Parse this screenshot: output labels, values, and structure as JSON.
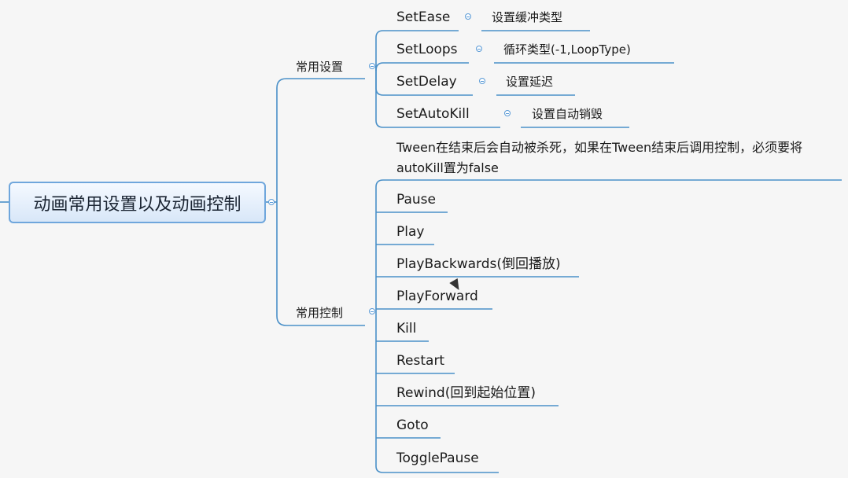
{
  "root": {
    "label": "动画常用设置以及动画控制"
  },
  "branches": {
    "settings": {
      "label": "常用设置",
      "children": [
        {
          "label": "SetEase",
          "note": "设置缓冲类型"
        },
        {
          "label": "SetLoops",
          "note": "循环类型(-1,LoopType)"
        },
        {
          "label": "SetDelay",
          "note": "设置延迟"
        },
        {
          "label": "SetAutoKill",
          "note": "设置自动销毁"
        }
      ],
      "autokill_note": "Tween在结束后会自动被杀死，如果在Tween结束后调用控制，必须要将autoKill置为false"
    },
    "controls": {
      "label": "常用控制",
      "children": [
        {
          "label": "Pause"
        },
        {
          "label": "Play"
        },
        {
          "label": "PlayBackwards(倒回播放)"
        },
        {
          "label": "PlayForward"
        },
        {
          "label": "Kill"
        },
        {
          "label": "Restart"
        },
        {
          "label": "Rewind(回到起始位置)"
        },
        {
          "label": "Goto"
        },
        {
          "label": "TogglePause"
        }
      ]
    }
  },
  "colors": {
    "connector": "#4a90c8",
    "root_border": "#6fa6dc",
    "background": "#f6f6f6"
  }
}
